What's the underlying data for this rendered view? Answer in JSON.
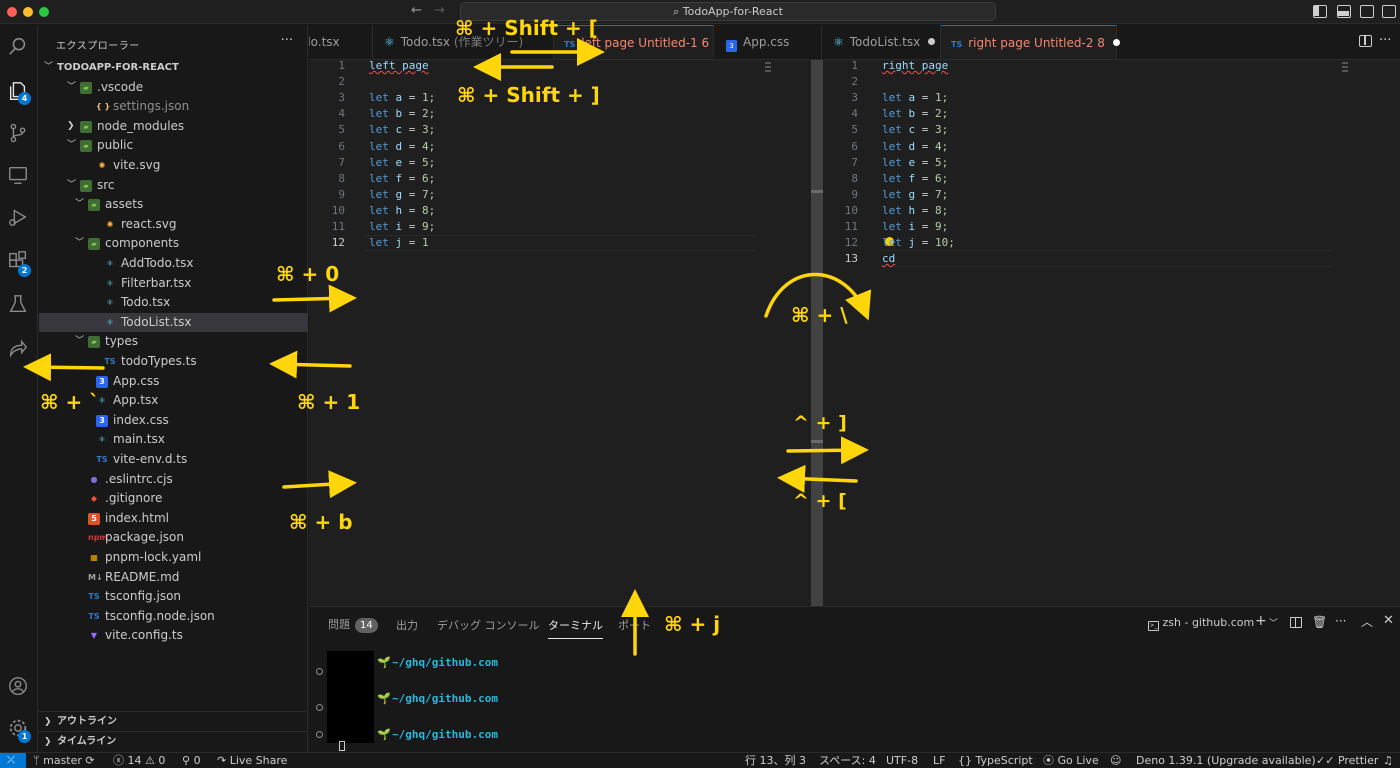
{
  "window": {
    "search_text": "TodoApp-for-React"
  },
  "activity_bar": {
    "explorer_badge": "4",
    "extensions_badge": "2",
    "settings_badge": "1"
  },
  "sidebar": {
    "title": "エクスプローラー",
    "more": "···",
    "project": "TODOAPP-FOR-REACT",
    "tree": [
      {
        "label": ".vscode",
        "kind": "folder",
        "depth": 1,
        "open": true
      },
      {
        "label": "settings.json",
        "kind": "json",
        "depth": 2
      },
      {
        "label": "node_modules",
        "kind": "folder",
        "depth": 1,
        "open": false
      },
      {
        "label": "public",
        "kind": "folder",
        "depth": 1,
        "open": true
      },
      {
        "label": "vite.svg",
        "kind": "svg",
        "depth": 2
      },
      {
        "label": "src",
        "kind": "folder",
        "depth": 1,
        "open": true
      },
      {
        "label": "assets",
        "kind": "folder",
        "depth": 2,
        "open": true
      },
      {
        "label": "react.svg",
        "kind": "svg",
        "depth": 3
      },
      {
        "label": "components",
        "kind": "folder",
        "depth": 2,
        "open": true
      },
      {
        "label": "AddTodo.tsx",
        "kind": "react",
        "depth": 3
      },
      {
        "label": "Filterbar.tsx",
        "kind": "react",
        "depth": 3
      },
      {
        "label": "Todo.tsx",
        "kind": "react",
        "depth": 3
      },
      {
        "label": "TodoList.tsx",
        "kind": "react",
        "depth": 3,
        "selected": true
      },
      {
        "label": "types",
        "kind": "folder",
        "depth": 2,
        "open": true
      },
      {
        "label": "todoTypes.ts",
        "kind": "ts",
        "depth": 3
      },
      {
        "label": "App.css",
        "kind": "css",
        "depth": 2
      },
      {
        "label": "App.tsx",
        "kind": "react",
        "depth": 2
      },
      {
        "label": "index.css",
        "kind": "css",
        "depth": 2
      },
      {
        "label": "main.tsx",
        "kind": "react",
        "depth": 2
      },
      {
        "label": "vite-env.d.ts",
        "kind": "ts",
        "depth": 2
      },
      {
        "label": ".eslintrc.cjs",
        "kind": "eslint",
        "depth": 1
      },
      {
        "label": ".gitignore",
        "kind": "git",
        "depth": 1
      },
      {
        "label": "index.html",
        "kind": "html",
        "depth": 1
      },
      {
        "label": "package.json",
        "kind": "npm",
        "depth": 1
      },
      {
        "label": "pnpm-lock.yaml",
        "kind": "pnpm",
        "depth": 1
      },
      {
        "label": "README.md",
        "kind": "md",
        "depth": 1
      },
      {
        "label": "tsconfig.json",
        "kind": "ts",
        "depth": 1
      },
      {
        "label": "tsconfig.node.json",
        "kind": "ts",
        "depth": 1
      },
      {
        "label": "vite.config.ts",
        "kind": "vite",
        "depth": 1
      }
    ],
    "outline": "アウトライン",
    "timeline": "タイムライン"
  },
  "left_tabs": {
    "tab1": "do.tsx",
    "tab2_name": "Todo.tsx",
    "tab2_desc": "(作業ツリー)",
    "tab3_name": "left page",
    "tab3_desc": "Untitled-1",
    "tab3_count": "6",
    "tab4": "App.css"
  },
  "right_tabs": {
    "tab1": "TodoList.tsx",
    "tab2_name": "right page",
    "tab2_desc": "Untitled-2",
    "tab2_count": "8"
  },
  "left_editor": {
    "line_numbers": [
      "1",
      "2",
      "3",
      "4",
      "5",
      "6",
      "7",
      "8",
      "9",
      "10",
      "11",
      "12"
    ],
    "title_line": "left page",
    "decls": [
      {
        "name": "a",
        "value": "1;"
      },
      {
        "name": "b",
        "value": "2;"
      },
      {
        "name": "c",
        "value": "3;"
      },
      {
        "name": "d",
        "value": "4;"
      },
      {
        "name": "e",
        "value": "5;"
      },
      {
        "name": "f",
        "value": "6;"
      },
      {
        "name": "g",
        "value": "7;"
      },
      {
        "name": "h",
        "value": "8;"
      },
      {
        "name": "i",
        "value": "9;"
      },
      {
        "name": "j",
        "value": "1"
      }
    ]
  },
  "right_editor": {
    "line_numbers": [
      "1",
      "2",
      "3",
      "4",
      "5",
      "6",
      "7",
      "8",
      "9",
      "10",
      "11",
      "12",
      "13"
    ],
    "title_line": "right page",
    "decls": [
      {
        "name": "a",
        "value": "1;"
      },
      {
        "name": "b",
        "value": "2;"
      },
      {
        "name": "c",
        "value": "3;"
      },
      {
        "name": "d",
        "value": "4;"
      },
      {
        "name": "e",
        "value": "5;"
      },
      {
        "name": "f",
        "value": "6;"
      },
      {
        "name": "g",
        "value": "7;"
      },
      {
        "name": "h",
        "value": "8;"
      },
      {
        "name": "i",
        "value": "9;"
      },
      {
        "name": "j",
        "value": "10;"
      }
    ],
    "last_line": "cd"
  },
  "panel": {
    "tabs": [
      "問題",
      "出力",
      "デバッグ コンソール",
      "ターミナル",
      "ポート"
    ],
    "problems_count": "14",
    "terminal_name": "zsh - github.com",
    "terminal_lines": [
      "~/ghq/github.com",
      "~/ghq/github.com",
      "~/ghq/github.com"
    ]
  },
  "status_bar": {
    "branch": "master",
    "errors": "14",
    "warnings": "0",
    "ports": "0",
    "live_share": "Live Share",
    "cursor": "行 13、列 3",
    "spaces": "スペース: 4",
    "encoding": "UTF-8",
    "eol": "LF",
    "language": "TypeScript",
    "go_live": "Go Live",
    "deno": "Deno 1.39.1 (Upgrade available)",
    "prettier": "Prettier"
  },
  "annotations": {
    "prev_tab": "⌘ + Shift + [",
    "next_tab": "⌘ + Shift +  ]",
    "focus_sidebar": "⌘ + 0",
    "focus_editor": "⌘ + 1",
    "toggle_sidebar": "⌘ + b",
    "activity": "⌘ + `",
    "split": "⌘ + \\",
    "nav_forward": "^ + ]",
    "nav_back": "^ + [",
    "toggle_panel": "⌘ + j"
  },
  "colors": {
    "accent": "#0078d4",
    "annotation": "#ffd60a",
    "modified_tab": "#f48771"
  }
}
